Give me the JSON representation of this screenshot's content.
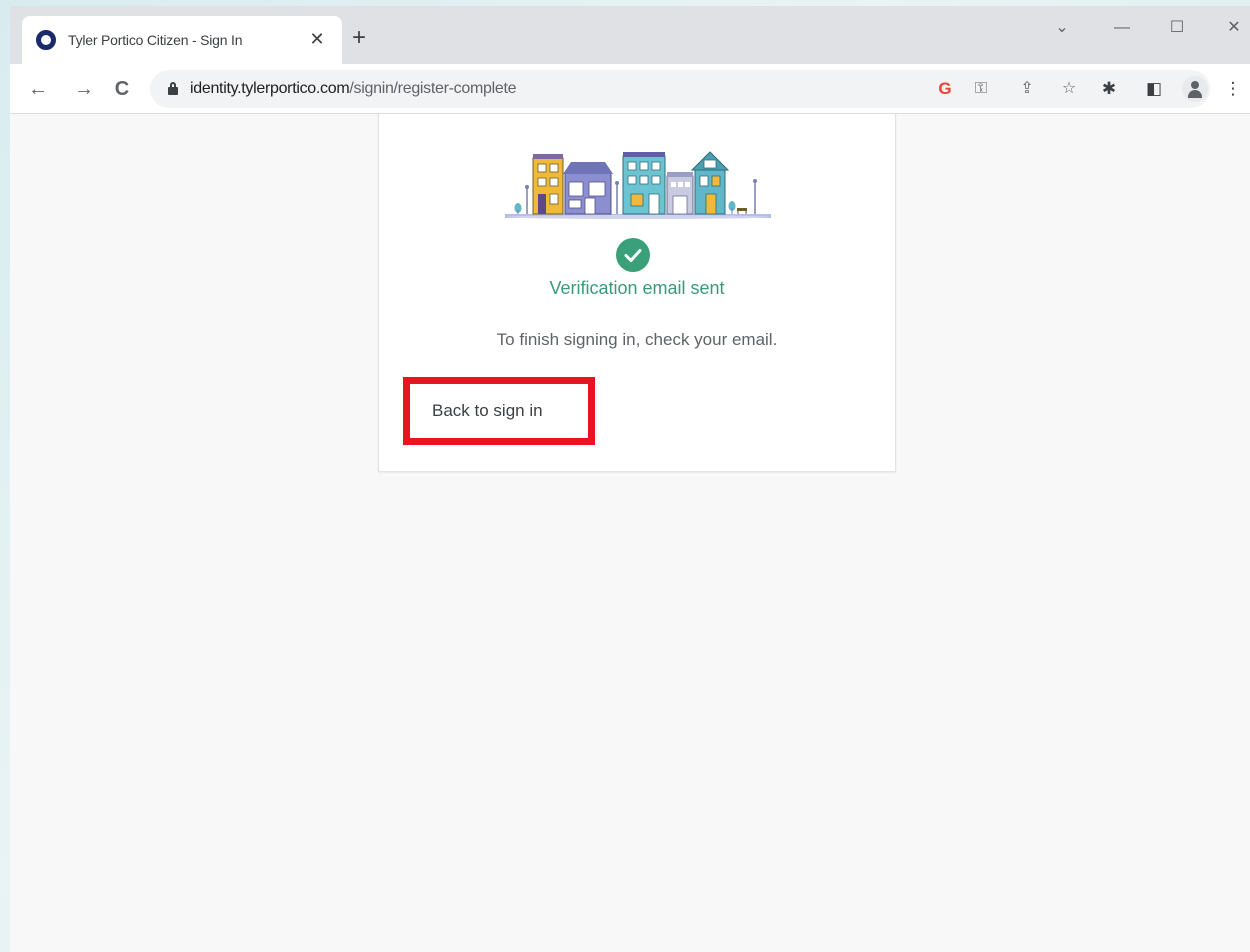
{
  "browser": {
    "tab": {
      "title": "Tyler Portico Citizen - Sign In",
      "close": "✕",
      "new_tab": "+"
    },
    "window_controls": {
      "collapse": "⌄",
      "minimize": "—",
      "maximize": "☐",
      "close": "✕"
    },
    "nav": {
      "back": "←",
      "forward": "→",
      "reload": "C"
    },
    "address_bar": {
      "host": "identity.tylerportico.com",
      "path": "/signin/register-complete"
    },
    "omnibox_icons": {
      "google": "G",
      "key": "⚿",
      "share": "⇪",
      "star": "☆"
    },
    "toolbar_icons": {
      "extensions": "✱",
      "side_panel": "◧",
      "menu": "⋮"
    }
  },
  "card": {
    "heading": "Verification email sent",
    "message": "To finish signing in, check your email.",
    "back_link": "Back to sign in"
  },
  "colors": {
    "success": "#3aa07a",
    "highlight": "#e8141f"
  }
}
